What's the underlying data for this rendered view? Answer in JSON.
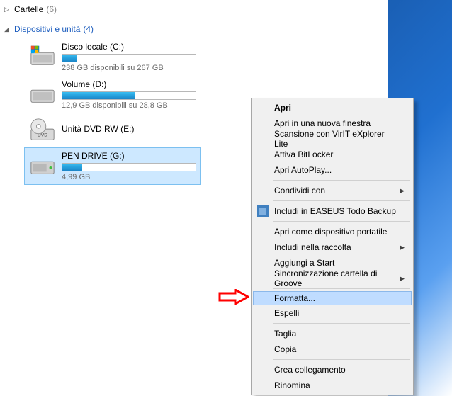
{
  "groups": {
    "folders": {
      "label": "Cartelle",
      "count": "(6)"
    },
    "devices": {
      "label": "Dispositivi e unità",
      "count": "(4)"
    }
  },
  "drives": {
    "c": {
      "name": "Disco locale (C:)",
      "sub": "238 GB disponibili su 267 GB",
      "fill": 11
    },
    "d": {
      "name": "Volume (D:)",
      "sub": "12,9 GB disponibili su 28,8 GB",
      "fill": 55
    },
    "dvd": {
      "name": "Unità DVD RW (E:)"
    },
    "g": {
      "name": "PEN DRIVE (G:)",
      "sub": "4,99 GB",
      "fill": 15
    }
  },
  "menu": {
    "open": "Apri",
    "open_new": "Apri in una nuova finestra",
    "virit": "Scansione con VirIT eXplorer Lite",
    "bitlocker": "Attiva BitLocker",
    "autoplay": "Apri AutoPlay...",
    "share": "Condividi con",
    "easeus": "Includi in EASEUS Todo Backup",
    "portable": "Apri come dispositivo portatile",
    "library": "Includi nella raccolta",
    "pin": "Aggiungi a Start",
    "groove": "Sincronizzazione cartella di Groove",
    "format": "Formatta...",
    "eject": "Espelli",
    "cut": "Taglia",
    "copy": "Copia",
    "shortcut": "Crea collegamento",
    "rename": "Rinomina"
  }
}
